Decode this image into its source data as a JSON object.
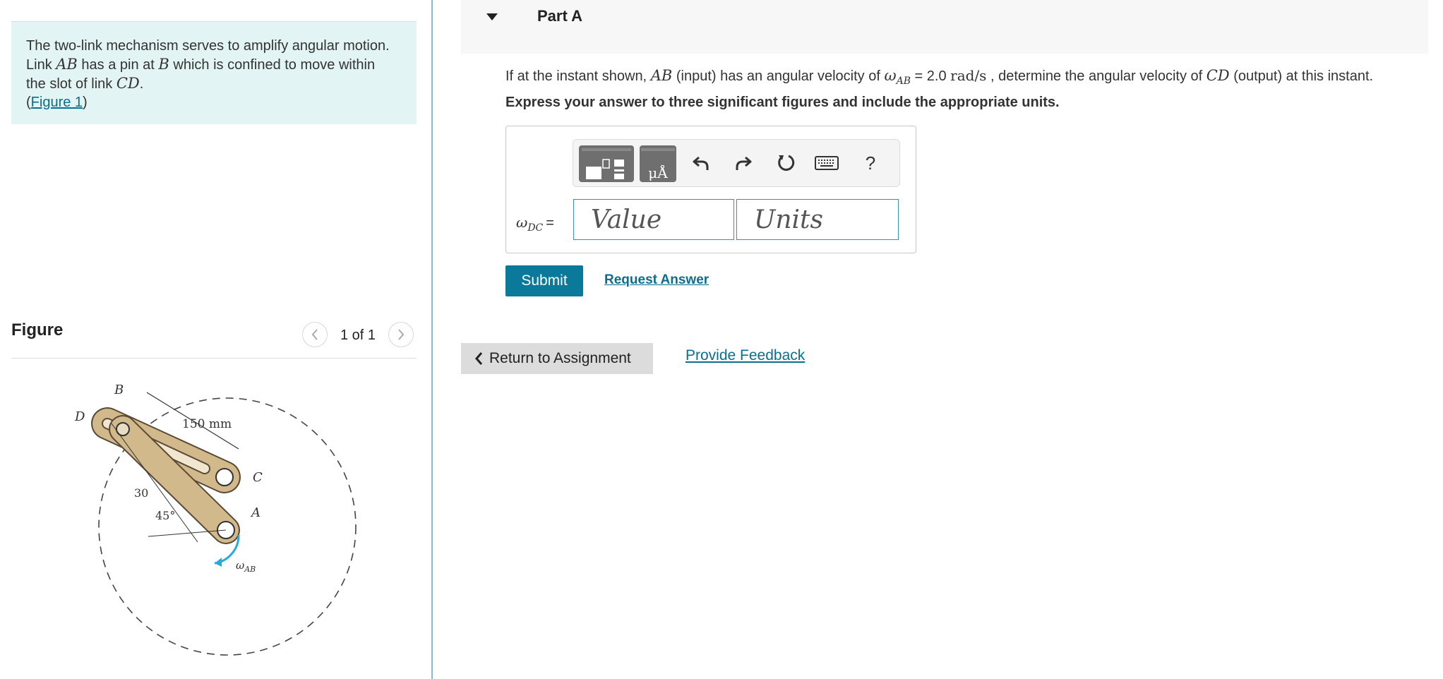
{
  "problem": {
    "line1": "The two-link mechanism serves to amplify angular motion.",
    "t_link": "Link ",
    "sym_AB": "AB",
    "t_pin": " has a pin at ",
    "sym_B": "B",
    "t_confined": " which is confined to move within",
    "t_slot": "the slot of link ",
    "sym_CD": "CD",
    "t_period": ".",
    "paren_open": "(",
    "figure_link": "Figure 1",
    "paren_close": ")"
  },
  "figure": {
    "title": "Figure",
    "counter": "1 of 1",
    "labels": {
      "B": "B",
      "D": "D",
      "C": "C",
      "A": "A",
      "dim": "150 mm",
      "angle30": "30",
      "angle45": "45°",
      "omega": "ω",
      "omega_sub": "AB"
    }
  },
  "part": {
    "title": "Part A",
    "q_pre": "If at the instant shown, ",
    "q_AB": "AB",
    "q_mid": " (input) has an angular velocity of ",
    "q_omega": "ω",
    "q_omega_sub": "AB",
    "q_eq": " = 2.0 ",
    "q_unit": "rad/s",
    "q_post": " , determine the angular velocity of ",
    "q_CD": "CD",
    "q_end": " (output) at this instant.",
    "instruction": "Express your answer to three significant figures and include the appropriate units."
  },
  "answer": {
    "var": "ω",
    "var_sub": "DC",
    "eq": "=",
    "value_placeholder": "Value",
    "units_placeholder": "Units",
    "help": "?"
  },
  "actions": {
    "submit": "Submit",
    "request": "Request Answer",
    "return": "Return to Assignment",
    "feedback": "Provide Feedback"
  }
}
